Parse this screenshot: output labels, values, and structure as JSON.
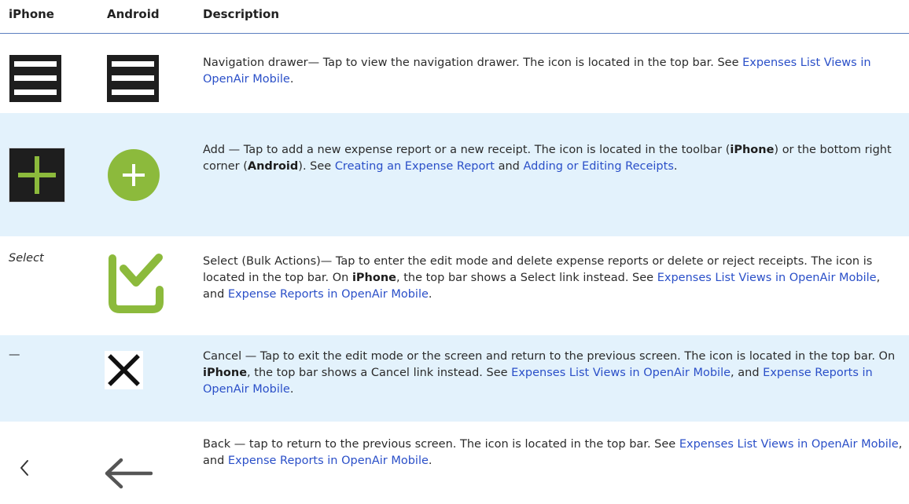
{
  "header": {
    "iphone": "iPhone",
    "android": "Android",
    "description": "Description"
  },
  "rows": [
    {
      "name": "navigation-drawer",
      "iphone_icon": "hamburger-icon",
      "android_icon": "hamburger-icon",
      "parts": [
        "Navigation drawer— Tap to view the navigation drawer. The icon is located in the top bar. See ",
        "Expenses List Views in OpenAir Mobile",
        "."
      ]
    },
    {
      "name": "add",
      "iphone_icon": "plus-square-icon",
      "android_icon": "plus-circle-icon",
      "parts": [
        "Add — Tap to add a new expense report or a new receipt. The icon is located in the toolbar (",
        "iPhone",
        ") or the bottom right corner (",
        "Android",
        "). See ",
        "Creating an Expense Report",
        " and ",
        "Adding or Editing Receipts",
        "."
      ]
    },
    {
      "name": "select",
      "iphone_text": "Select",
      "android_icon": "select-check-icon",
      "parts": [
        "Select (Bulk Actions)— Tap to enter the edit mode and delete expense reports or delete or reject receipts. The icon is located in the top bar. On ",
        "iPhone",
        ", the top bar shows a Select link instead. See ",
        "Expenses List Views in OpenAir Mobile",
        ", and ",
        "Expense Reports in OpenAir Mobile",
        "."
      ]
    },
    {
      "name": "cancel",
      "iphone_text": "—",
      "android_icon": "close-icon",
      "parts": [
        "Cancel — Tap to exit the edit mode or the screen and return to the previous screen. The icon is located in the top bar. On ",
        "iPhone",
        ", the top bar shows a Cancel link instead. See ",
        "Expenses List Views in OpenAir Mobile",
        ", and ",
        "Expense Reports in OpenAir Mobile",
        "."
      ]
    },
    {
      "name": "back",
      "iphone_icon": "chevron-left-icon",
      "android_icon": "arrow-left-icon",
      "parts": [
        "Back — tap to return to the previous screen. The icon is located in the top bar. See ",
        "Expenses List Views in OpenAir Mobile",
        ", and ",
        "Expense Reports in OpenAir Mobile",
        "."
      ]
    }
  ],
  "colors": {
    "link": "#2a4fc8",
    "stripe": "#e3f2fc",
    "add_green": "#8cba3c",
    "header_rule": "#5b7fbf"
  }
}
